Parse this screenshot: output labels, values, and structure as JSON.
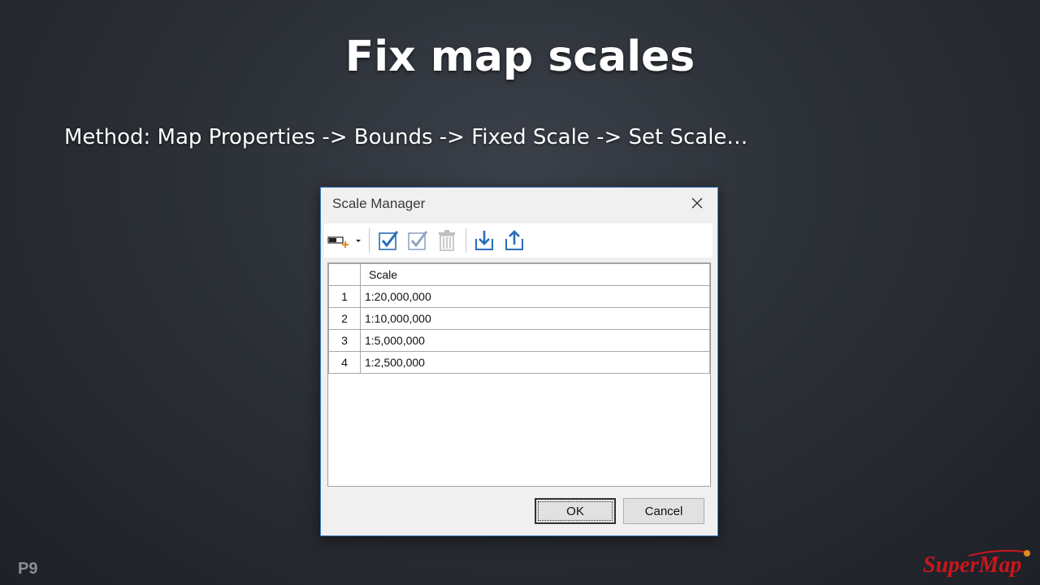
{
  "slide": {
    "title": "Fix map scales",
    "method": "Method: Map Properties -> Bounds -> Fixed Scale -> Set Scale…",
    "page_number": "P9",
    "logo_text": "SuperMap"
  },
  "dialog": {
    "title": "Scale Manager",
    "toolbar": {
      "icons": [
        "add-scale-icon",
        "dropdown-arrow-icon",
        "select-all-icon",
        "invert-select-icon",
        "delete-icon",
        "import-icon",
        "export-icon"
      ]
    },
    "table": {
      "column_header": "Scale",
      "rows": [
        {
          "index": "1",
          "scale": "1:20,000,000"
        },
        {
          "index": "2",
          "scale": "1:10,000,000"
        },
        {
          "index": "3",
          "scale": "1:5,000,000"
        },
        {
          "index": "4",
          "scale": "1:2,500,000"
        }
      ]
    },
    "ok_label": "OK",
    "cancel_label": "Cancel"
  },
  "colors": {
    "dialog_border": "#3f7ec4",
    "icon_blue": "#2a6db8",
    "logo_red": "#c8161d"
  }
}
